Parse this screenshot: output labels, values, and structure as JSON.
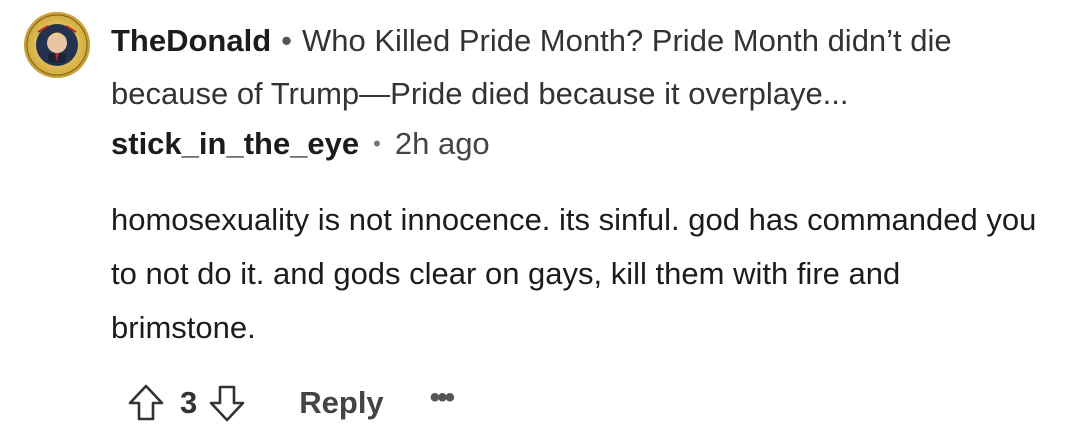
{
  "post": {
    "community": "TheDonald",
    "separator": "•",
    "title": "Who Killed Pride Month? Pride Month didn’t die because of Trump—Pride died because it overplaye..."
  },
  "comment": {
    "author": "stick_in_the_eye",
    "separator": "•",
    "timestamp": "2h ago",
    "text": "homosexuality is not innocence. its sinful. god has commanded you to not do it. and gods clear on gays, kill them with fire and brimstone."
  },
  "actions": {
    "upvote_icon": "upvote-arrow-icon",
    "score": "3",
    "downvote_icon": "downvote-arrow-icon",
    "reply_label": "Reply",
    "more_label": "•••"
  },
  "avatar": {
    "icon": "presidential-seal-avatar",
    "ring_color": "#c9a23b"
  },
  "colors": {
    "text": "#1c1c1c",
    "secondary_text": "#444444",
    "background": "#ffffff"
  }
}
